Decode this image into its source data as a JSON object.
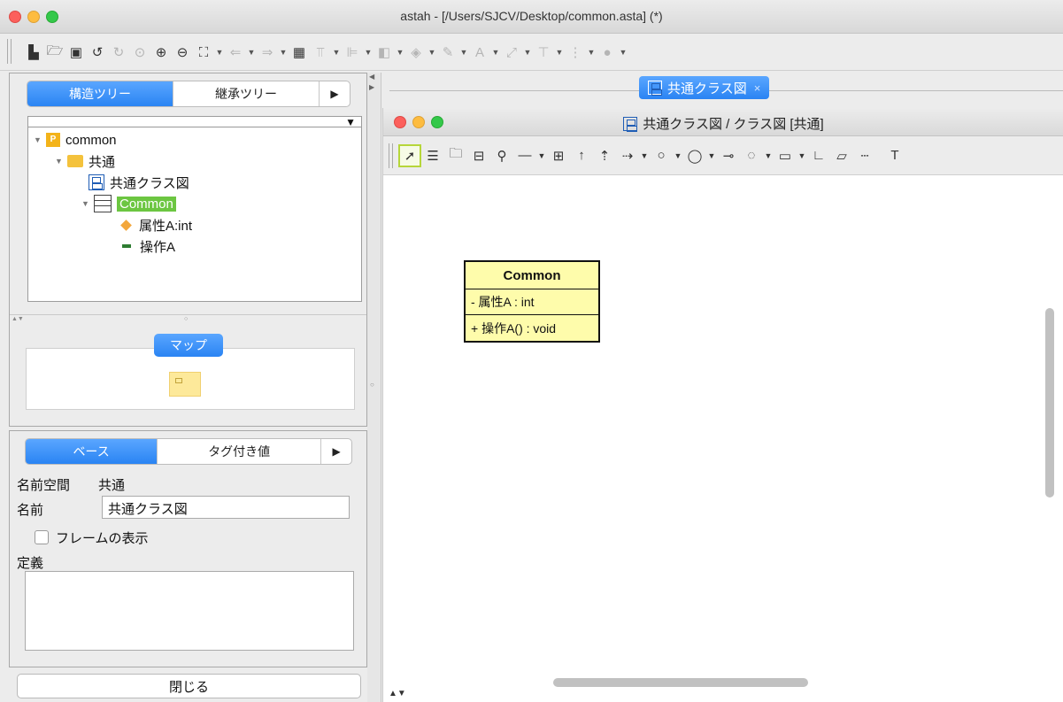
{
  "window": {
    "title": "astah - [/Users/SJCV/Desktop/common.asta] (*)"
  },
  "toolbar": {
    "icons": [
      "new-file-icon",
      "open-folder-icon",
      "save-icon",
      "undo-icon",
      "redo-icon",
      "zoom-fit-icon",
      "zoom-in-icon",
      "zoom-out-icon",
      "fit-window-icon",
      "back-icon",
      "forward-icon",
      "grid-icon",
      "align-top-icon",
      "align-left-icon",
      "front-back-icon",
      "fill-color-icon",
      "line-color-icon",
      "font-color-icon",
      "line-style-icon",
      "layout-icon",
      "snap-icon",
      "style-icon"
    ]
  },
  "left_panel": {
    "tabs": [
      {
        "label": "構造ツリー",
        "active": true
      },
      {
        "label": "継承ツリー",
        "active": false
      },
      {
        "label": "▶",
        "active": false
      }
    ],
    "tree": [
      {
        "label": "common",
        "icon": "package-icon",
        "expanded": true,
        "depth": 0
      },
      {
        "label": "共通",
        "icon": "folder-icon",
        "expanded": true,
        "depth": 1
      },
      {
        "label": "共通クラス図",
        "icon": "class-diagram-icon",
        "depth": 2
      },
      {
        "label": "Common",
        "icon": "class-icon",
        "expanded": true,
        "selected": true,
        "depth": 2
      },
      {
        "label": "属性A:int",
        "icon": "attribute-icon",
        "depth": 3
      },
      {
        "label": "操作A",
        "icon": "operation-icon",
        "depth": 3
      }
    ],
    "map_button": "マップ"
  },
  "properties": {
    "tabs": [
      {
        "label": "ベース",
        "active": true
      },
      {
        "label": "タグ付き値",
        "active": false
      },
      {
        "label": "▶",
        "active": false
      }
    ],
    "namespace_label": "名前空間",
    "namespace_value": "共通",
    "name_label": "名前",
    "name_value": "共通クラス図",
    "frame_checkbox_label": "フレームの表示",
    "frame_checked": false,
    "definition_label": "定義",
    "definition_value": "",
    "close_button": "閉じる"
  },
  "editor": {
    "doc_tab": "共通クラス図",
    "doc_tab_close": "×",
    "inner_title": "共通クラス図 / クラス図 [共通]",
    "diagram_class": {
      "name": "Common",
      "attribute": "- 属性A : int",
      "operation": "+ 操作A() : void"
    },
    "tool_icons": [
      "select-icon",
      "class-icon",
      "package-icon",
      "subsystem-icon",
      "interface-icon",
      "association-icon",
      "association-class-icon",
      "generalization-icon",
      "realization-icon",
      "dependency-icon",
      "usage-icon",
      "aggregation-icon",
      "composition-icon",
      "instance-icon",
      "frame-icon",
      "note-icon",
      "anchor-icon",
      "text-icon"
    ],
    "text_tool": "T",
    "corner_arrows": "▲▼"
  }
}
